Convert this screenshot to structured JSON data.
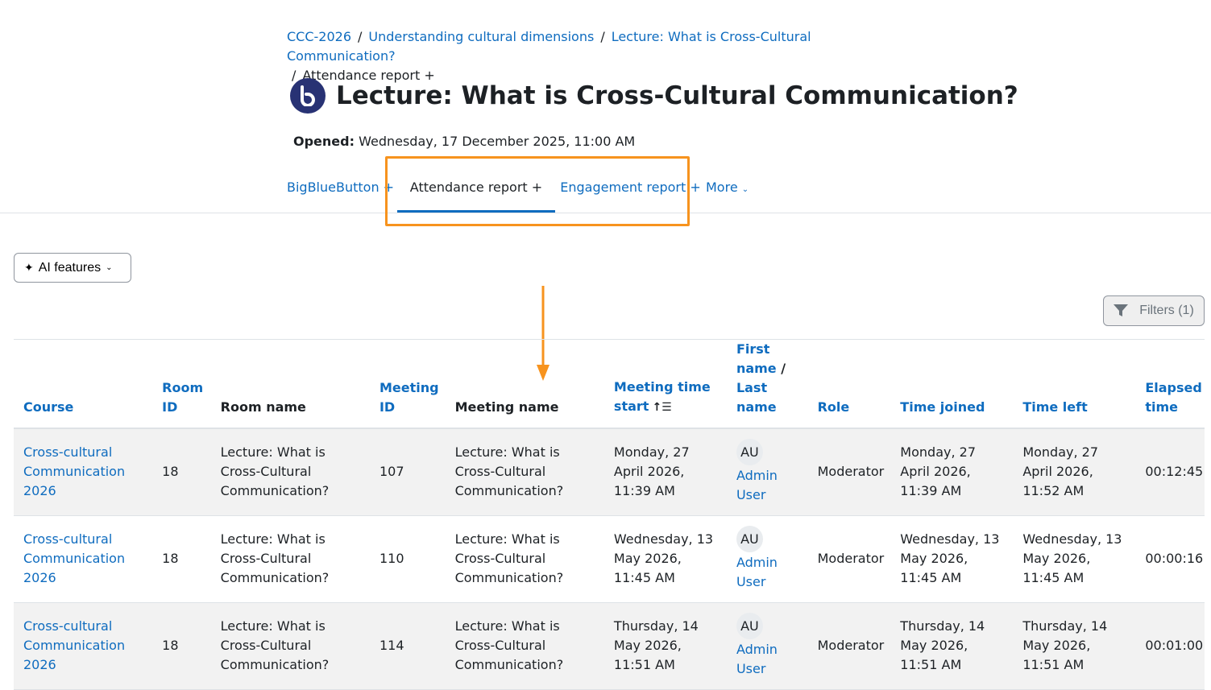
{
  "breadcrumb": {
    "items": [
      "CCC-2026",
      "Understanding cultural dimensions",
      "Lecture: What is Cross-Cultural Communication?"
    ],
    "current": "Attendance report +"
  },
  "page": {
    "title": "Lecture: What is Cross-Cultural Communication?",
    "opened_label": "Opened:",
    "opened_value": "Wednesday, 17 December 2025, 11:00 AM"
  },
  "tabs": [
    "BigBlueButton +",
    "Attendance report +",
    "Engagement report +",
    "More"
  ],
  "active_tab": "Attendance report +",
  "toolbar": {
    "ai_label": "AI features",
    "filters_label": "Filters (1)"
  },
  "table": {
    "headers": {
      "course": "Course",
      "room_id": "Room ID",
      "room_name": "Room name",
      "meeting_id": "Meeting ID",
      "meeting_name": "Meeting name",
      "meeting_time_start": "Meeting time start",
      "first_name": "First name",
      "last_name": "Last name",
      "role": "Role",
      "time_joined": "Time joined",
      "time_left": "Time left",
      "elapsed_time": "Elapsed time"
    },
    "rows": [
      {
        "course": "Cross-cultural Communication 2026",
        "room_id": "18",
        "room_name": "Lecture: What is Cross-Cultural Communication?",
        "meeting_id": "107",
        "meeting_name": "Lecture: What is Cross-Cultural Communication?",
        "meeting_time_start": "Monday, 27 April 2026, 11:39 AM",
        "initials": "AU",
        "user": "Admin User",
        "role": "Moderator",
        "time_joined": "Monday, 27 April 2026, 11:39 AM",
        "time_left": "Monday, 27 April 2026, 11:52 AM",
        "elapsed_time": "00:12:45"
      },
      {
        "course": "Cross-cultural Communication 2026",
        "room_id": "18",
        "room_name": "Lecture: What is Cross-Cultural Communication?",
        "meeting_id": "110",
        "meeting_name": "Lecture: What is Cross-Cultural Communication?",
        "meeting_time_start": "Wednesday, 13 May 2026, 11:45 AM",
        "initials": "AU",
        "user": "Admin User",
        "role": "Moderator",
        "time_joined": "Wednesday, 13 May 2026, 11:45 AM",
        "time_left": "Wednesday, 13 May 2026, 11:45 AM",
        "elapsed_time": "00:00:16"
      },
      {
        "course": "Cross-cultural Communication 2026",
        "room_id": "18",
        "room_name": "Lecture: What is Cross-Cultural Communication?",
        "meeting_id": "114",
        "meeting_name": "Lecture: What is Cross-Cultural Communication?",
        "meeting_time_start": "Thursday, 14 May 2026, 11:51 AM",
        "initials": "AU",
        "user": "Admin User",
        "role": "Moderator",
        "time_joined": "Thursday, 14 May 2026, 11:51 AM",
        "time_left": "Thursday, 14 May 2026, 11:51 AM",
        "elapsed_time": "00:01:00"
      }
    ]
  },
  "colors": {
    "link": "#0f6cbf",
    "text": "#1d2125",
    "highlight": "#f7931e",
    "bbb_logo": "#283274",
    "row_stripe": "#f2f2f2"
  }
}
